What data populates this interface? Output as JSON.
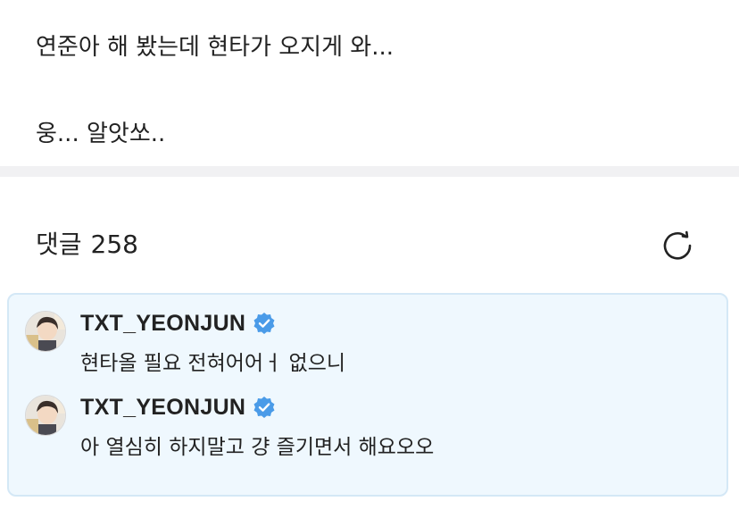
{
  "post": {
    "line1": "연준아 해 봤는데 현타가 오지게 와...",
    "line2": "웅... 알앗쏘.."
  },
  "comments_header": {
    "title": "댓글",
    "count": "258",
    "refresh_icon": "refresh-icon"
  },
  "comments": [
    {
      "author": "TXT_YEONJUN",
      "verified": true,
      "text": "현타올 필요 전혀어어ㅓ 없으니"
    },
    {
      "author": "TXT_YEONJUN",
      "verified": true,
      "text": "아 열심히 하지말고 걍 즐기면서 해요오오"
    }
  ],
  "colors": {
    "highlight_bg": "#eff8fe",
    "highlight_border": "#d4e8f6",
    "verified_badge": "#4a9be8",
    "divider": "#f1f1f3",
    "text": "#222222"
  }
}
